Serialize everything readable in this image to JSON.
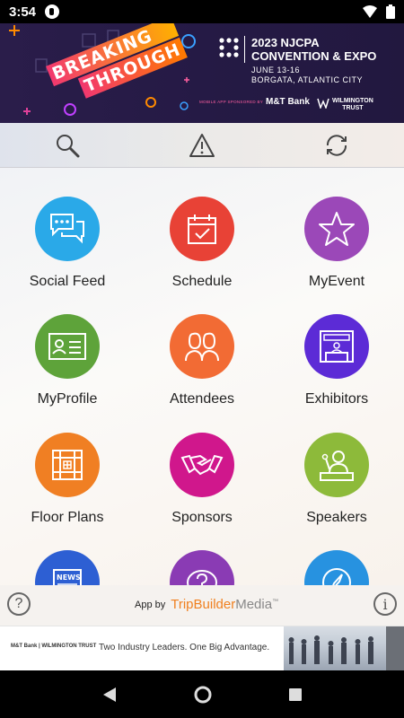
{
  "status_bar": {
    "time": "3:54",
    "icons": [
      "notification-icon",
      "wifi-icon",
      "battery-icon"
    ]
  },
  "banner": {
    "artwork_words": [
      "BREAKING",
      "THROUGH"
    ],
    "title_line1": "2023 NJCPA",
    "title_line2": "CONVENTION & EXPO",
    "date": "JUNE 13-16",
    "location": "BORGATA, ATLANTIC CITY",
    "sponsor_text": "MOBILE APP SPONSORED BY",
    "sponsor1": "M&T Bank",
    "sponsor2_line1": "WILMINGTON",
    "sponsor2_line2": "TRUST"
  },
  "toolbar": {
    "icons": [
      "search-icon",
      "alert-icon",
      "sync-icon"
    ]
  },
  "tiles": [
    {
      "label": "Social Feed",
      "icon": "chat-bubbles-icon",
      "color": "#2aa9e8"
    },
    {
      "label": "Schedule",
      "icon": "calendar-check-icon",
      "color": "#e84236"
    },
    {
      "label": "MyEvent",
      "icon": "star-icon",
      "color": "#9b48b8"
    },
    {
      "label": "MyProfile",
      "icon": "id-card-icon",
      "color": "#5ea33a"
    },
    {
      "label": "Attendees",
      "icon": "people-icon",
      "color": "#f26b34"
    },
    {
      "label": "Exhibitors",
      "icon": "booth-icon",
      "color": "#5c2bd6"
    },
    {
      "label": "Floor Plans",
      "icon": "floor-plan-icon",
      "color": "#f07f23"
    },
    {
      "label": "Sponsors",
      "icon": "handshake-icon",
      "color": "#d0178c"
    },
    {
      "label": "Speakers",
      "icon": "speaker-podium-icon",
      "color": "#8dba3a"
    },
    {
      "label": "",
      "icon": "news-icon",
      "color": "#2d5fd3"
    },
    {
      "label": "",
      "icon": "question-icon",
      "color": "#8a3bb4"
    },
    {
      "label": "",
      "icon": "compass-icon",
      "color": "#2792e0"
    }
  ],
  "footer": {
    "credit_prefix": "App by",
    "credit_brand_a": "TripBuilder",
    "credit_brand_b": "Media",
    "credit_tm": "™",
    "help_glyph": "?",
    "info_glyph": "i"
  },
  "ad": {
    "logos": "M&T Bank | WILMINGTON TRUST",
    "text": "Two Industry Leaders. One Big Advantage."
  },
  "nav": {
    "icons": [
      "back-icon",
      "home-icon",
      "recents-icon"
    ]
  }
}
